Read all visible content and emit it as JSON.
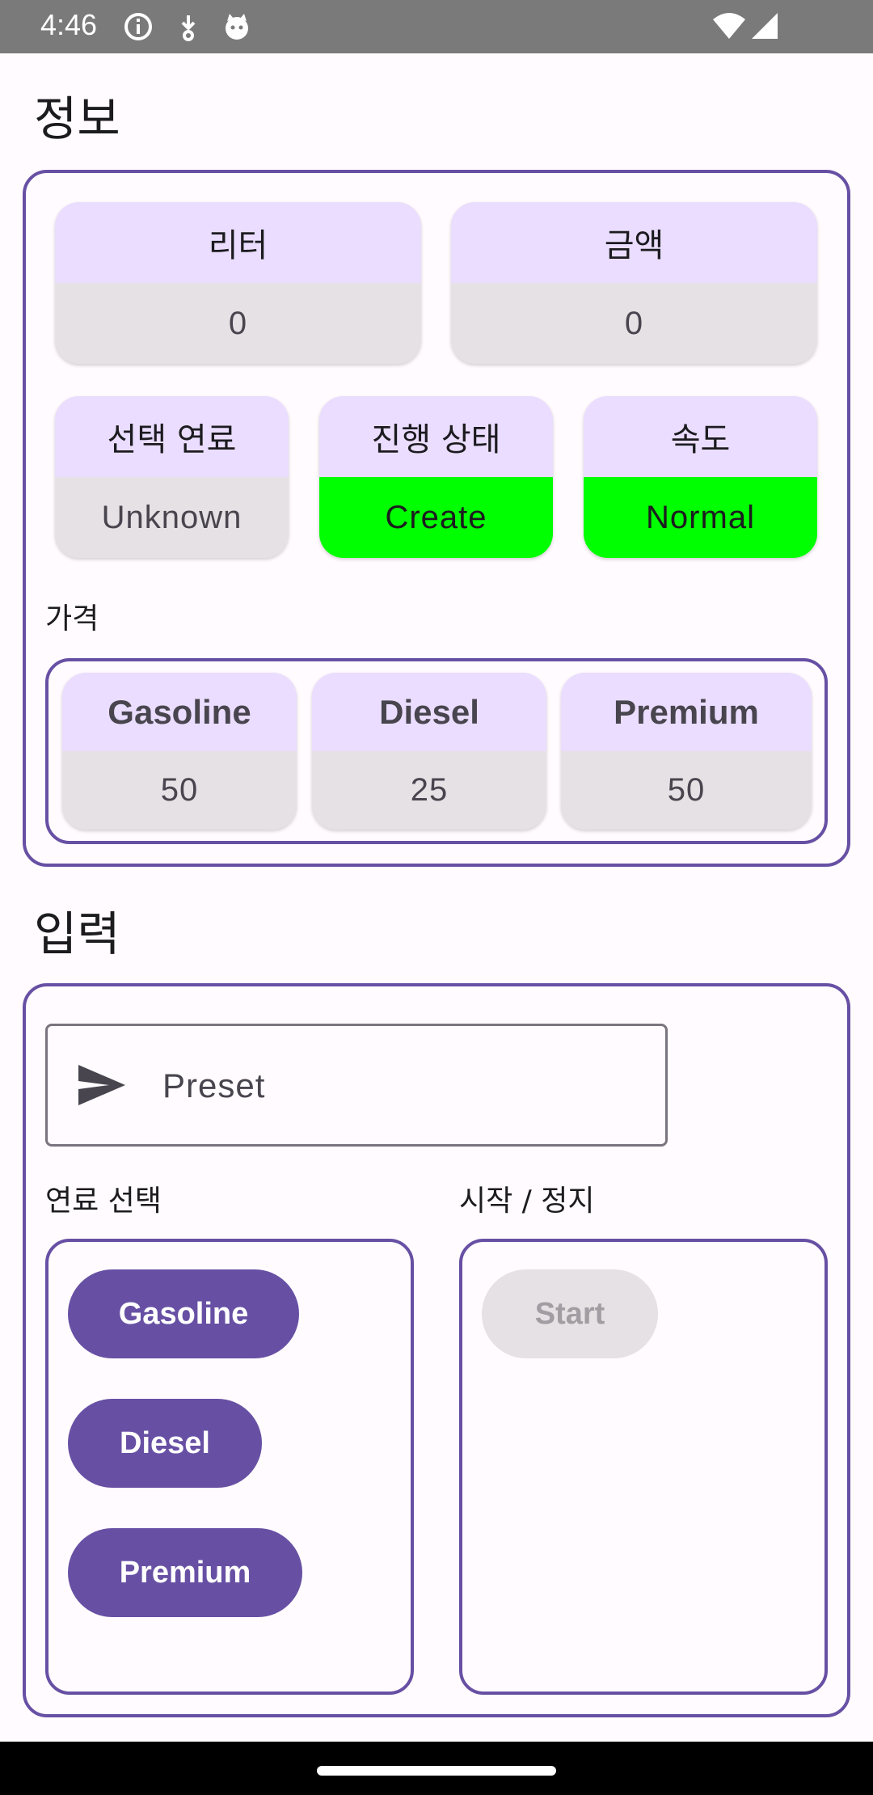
{
  "status_bar": {
    "time": "4:46",
    "icons_left": [
      "info-icon",
      "download-icon",
      "cat-icon"
    ],
    "icons_right": [
      "wifi-icon",
      "signal-icon"
    ]
  },
  "info_section": {
    "title": "정보",
    "liter": {
      "label": "리터",
      "value": "0"
    },
    "amount": {
      "label": "금액",
      "value": "0"
    },
    "fuel": {
      "label": "선택 연료",
      "value": "Unknown"
    },
    "progress": {
      "label": "진행 상태",
      "value": "Create"
    },
    "speed": {
      "label": "속도",
      "value": "Normal"
    },
    "price_label": "가격",
    "prices": [
      {
        "label": "Gasoline",
        "value": "50"
      },
      {
        "label": "Diesel",
        "value": "25"
      },
      {
        "label": "Premium",
        "value": "50"
      }
    ]
  },
  "input_section": {
    "title": "입력",
    "preset_placeholder": "Preset",
    "fuel_select_label": "연료 선택",
    "start_stop_label": "시작 / 정지",
    "fuel_buttons": [
      "Gasoline",
      "Diesel",
      "Premium"
    ],
    "start_button": "Start"
  },
  "colors": {
    "primary": "#6750A4",
    "status_green": "#00FF00",
    "card_top": "#EADDFF",
    "card_bottom": "#E6E1E5"
  }
}
